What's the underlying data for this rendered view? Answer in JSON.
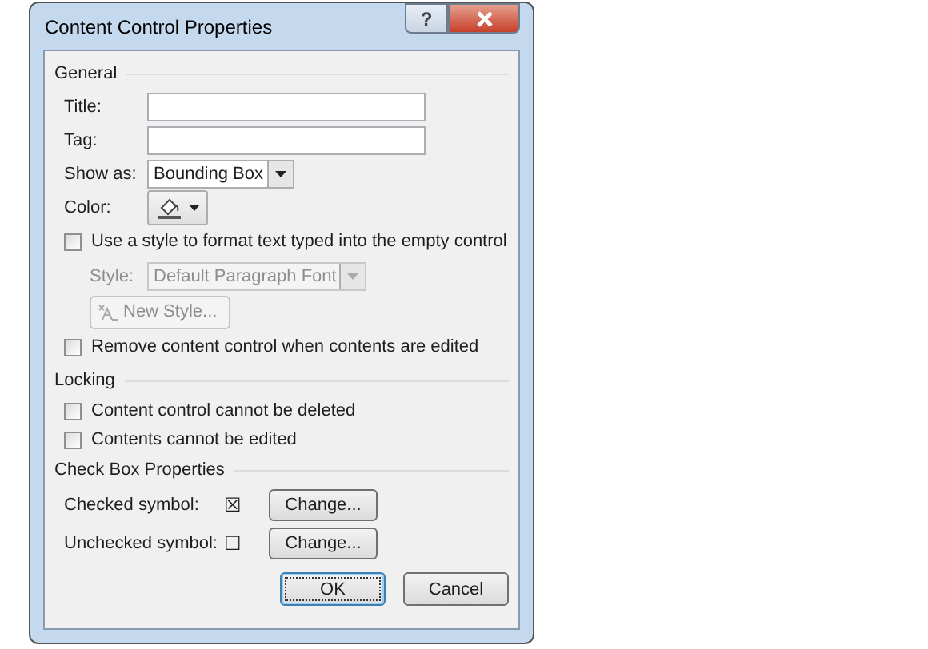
{
  "window": {
    "title": "Content Control Properties",
    "help_button": "?"
  },
  "general": {
    "heading": "General",
    "title_label": "Title:",
    "tag_label": "Tag:",
    "show_as_label": "Show as:",
    "show_as_value": "Bounding Box",
    "color_label": "Color:",
    "use_style": {
      "label": "Use a style to format text typed into the empty control",
      "checked": false
    },
    "style": {
      "label": "Style:",
      "value": "Default Paragraph Font",
      "disabled": true
    },
    "new_style_button": {
      "label": "New Style...",
      "disabled": true
    },
    "remove": {
      "label": "Remove content control when contents are edited",
      "checked": false
    }
  },
  "locking": {
    "heading": "Locking",
    "options": [
      {
        "label": "Content control cannot be deleted",
        "checked": false
      },
      {
        "label": "Contents cannot be edited",
        "checked": false
      }
    ]
  },
  "check_box_properties": {
    "heading": "Check Box Properties",
    "symbols": [
      {
        "label": "Checked symbol:",
        "symbol": "☒",
        "button": "Change..."
      },
      {
        "label": "Unchecked symbol:",
        "symbol": "☐",
        "button": "Change..."
      }
    ]
  },
  "buttons": [
    {
      "label": "OK",
      "default": true
    },
    {
      "label": "Cancel",
      "default": false
    }
  ]
}
